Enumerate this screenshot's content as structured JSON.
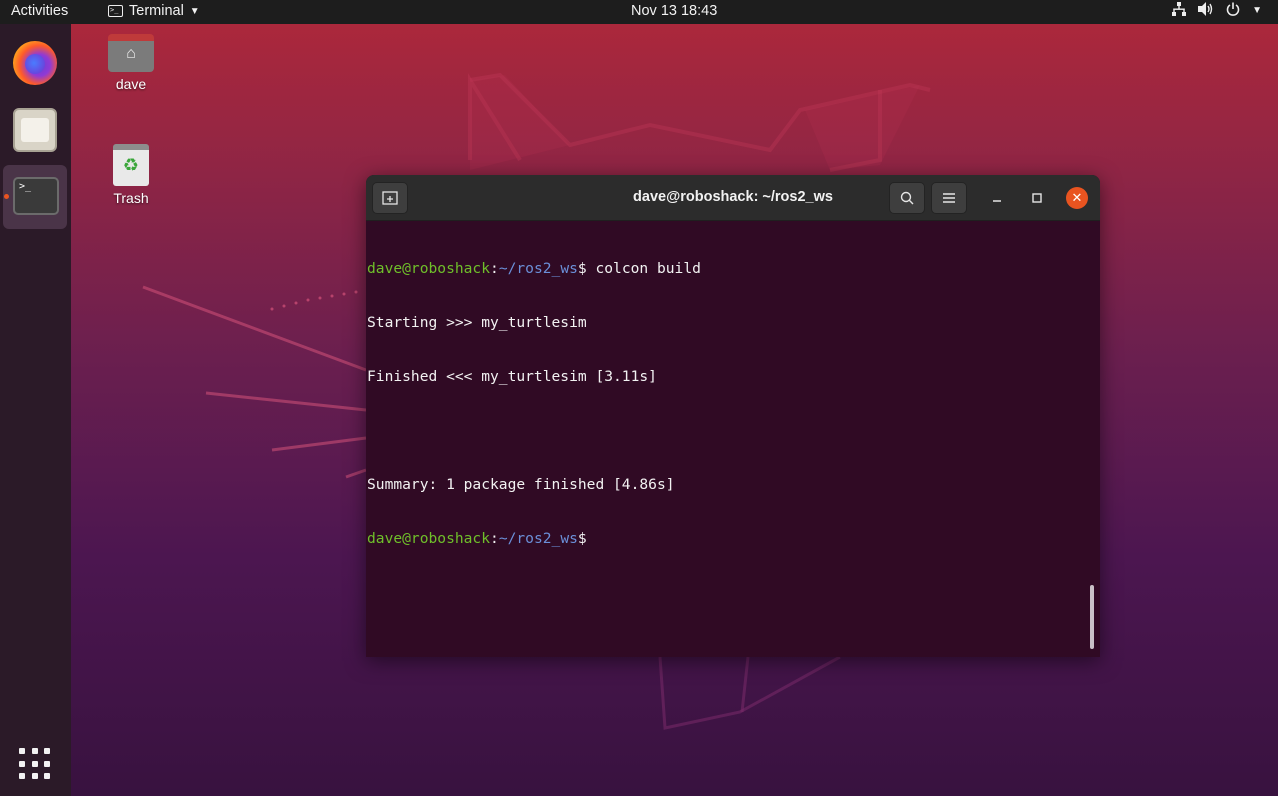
{
  "topbar": {
    "activities": "Activities",
    "app_name": "Terminal",
    "clock": "Nov 13  18:43"
  },
  "dock": {
    "items": [
      "firefox-icon",
      "files-icon",
      "terminal-icon"
    ],
    "active": "terminal-icon"
  },
  "desktop": {
    "home_label": "dave",
    "trash_label": "Trash"
  },
  "terminal": {
    "title": "dave@roboshack: ~/ros2_ws",
    "prompt_user": "dave@roboshack",
    "prompt_sep": ":",
    "prompt_path": "~/ros2_ws",
    "prompt_symbol": "$",
    "command": " colcon build",
    "output": [
      "Starting >>> my_turtlesim",
      "Finished <<< my_turtlesim [3.11s]",
      "",
      "Summary: 1 package finished [4.86s]"
    ]
  },
  "colors": {
    "accent": "#e95420",
    "terminal_bg": "#300a24",
    "prompt_user": "#6fbf2a",
    "prompt_path": "#6b8fd8"
  }
}
